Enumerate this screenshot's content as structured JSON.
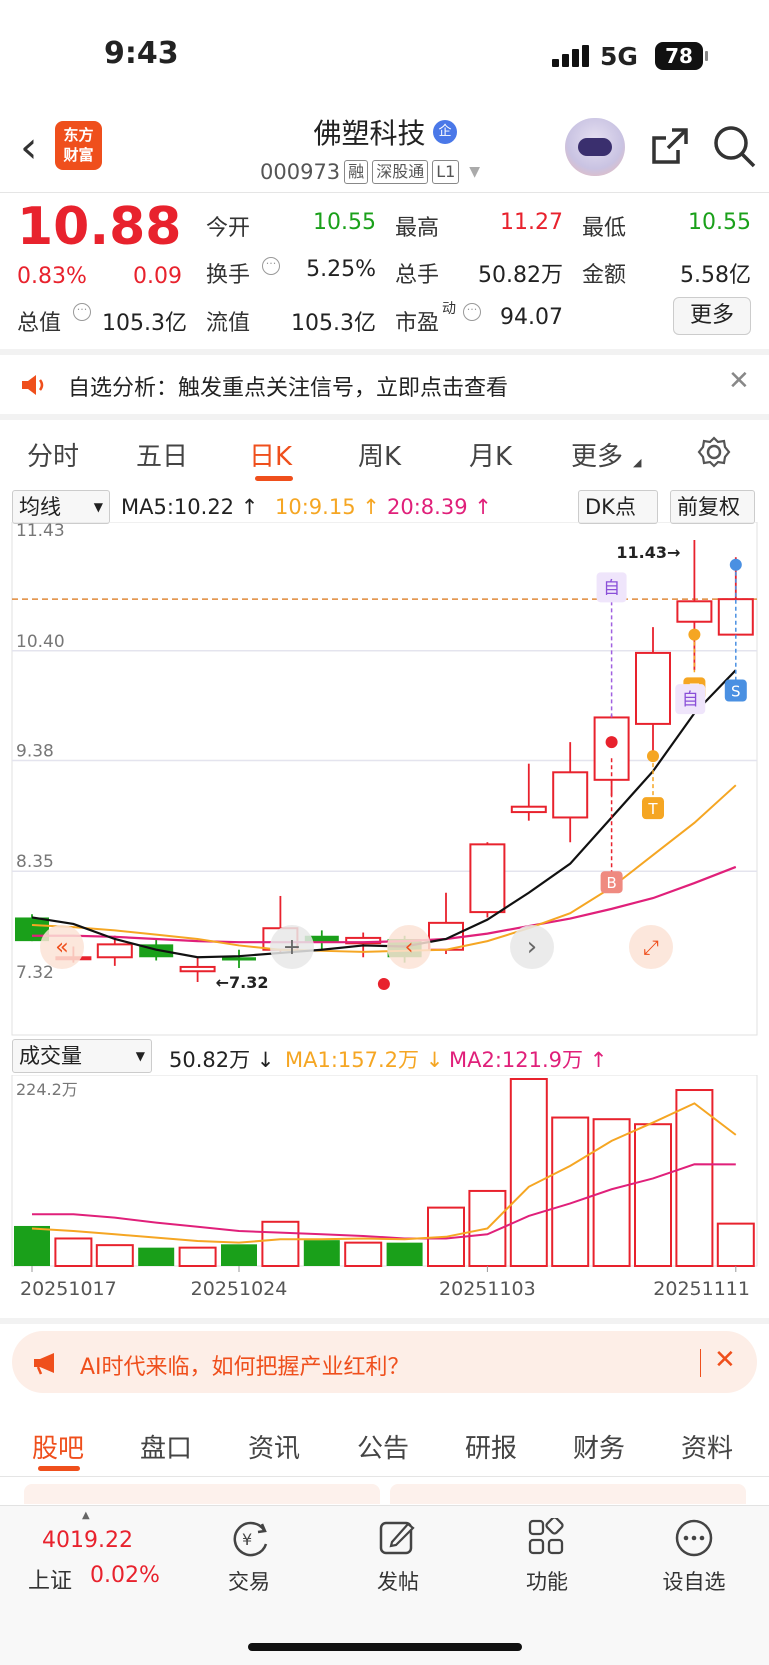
{
  "status": {
    "time": "9:43",
    "network": "5G",
    "battery": "78"
  },
  "header": {
    "logo_line1": "东方",
    "logo_line2": "财富",
    "stock_name": "佛塑科技",
    "badge": "企",
    "code": "000973",
    "tags": [
      "融",
      "深股通",
      "L1"
    ]
  },
  "quote": {
    "price": "10.88",
    "pct": "0.83%",
    "change": "0.09",
    "fields": [
      {
        "label": "今开",
        "value": "10.55",
        "color": "green"
      },
      {
        "label": "最高",
        "value": "11.27",
        "color": "red"
      },
      {
        "label": "最低",
        "value": "10.55",
        "color": "green"
      },
      {
        "label": "换手",
        "value": "5.25%",
        "color": "normal"
      },
      {
        "label": "总手",
        "value": "50.82万",
        "color": "normal"
      },
      {
        "label": "金额",
        "value": "5.58亿",
        "color": "normal"
      },
      {
        "label": "总值",
        "value": "105.3亿",
        "color": "normal"
      },
      {
        "label": "流值",
        "value": "105.3亿",
        "color": "normal"
      },
      {
        "label": "市盈",
        "superscript": "动",
        "value": "94.07",
        "color": "normal"
      }
    ],
    "more_button": "更多"
  },
  "notice": {
    "text": "自选分析：触发重点关注信号，立即点击查看"
  },
  "tabs": [
    "分时",
    "五日",
    "日K",
    "周K",
    "月K",
    "更多"
  ],
  "chart_controls": {
    "indicator": "均线",
    "ma5": "MA5:10.22",
    "ma10": "10:9.15",
    "ma20": "20:8.39",
    "dk": "DK点",
    "adjust": "前复权"
  },
  "chart_data": [
    {
      "type": "candlestick",
      "y_ticks": [
        "11.43",
        "10.40",
        "9.38",
        "8.35",
        "7.32"
      ],
      "ylim": [
        7.32,
        11.43
      ],
      "reference_line": 10.88,
      "max_label": "11.43",
      "min_label": "7.32",
      "candles": [
        {
          "o": 7.7,
          "c": 7.92,
          "h": 7.95,
          "l": 7.7,
          "up": false
        },
        {
          "o": 7.55,
          "c": 7.55,
          "h": 7.65,
          "l": 7.5,
          "up": true
        },
        {
          "o": 7.55,
          "c": 7.67,
          "h": 7.75,
          "l": 7.47,
          "up": true
        },
        {
          "o": 7.67,
          "c": 7.55,
          "h": 7.72,
          "l": 7.52,
          "up": false
        },
        {
          "o": 7.42,
          "c": 7.46,
          "h": 7.55,
          "l": 7.32,
          "up": true
        },
        {
          "o": 7.55,
          "c": 7.52,
          "h": 7.62,
          "l": 7.45,
          "up": false
        },
        {
          "o": 7.62,
          "c": 7.82,
          "h": 8.12,
          "l": 7.58,
          "up": true
        },
        {
          "o": 7.75,
          "c": 7.69,
          "h": 7.8,
          "l": 7.62,
          "up": false
        },
        {
          "o": 7.68,
          "c": 7.73,
          "h": 7.78,
          "l": 7.55,
          "up": true
        },
        {
          "o": 7.72,
          "c": 7.55,
          "h": 7.75,
          "l": 7.5,
          "up": false
        },
        {
          "o": 7.62,
          "c": 7.87,
          "h": 8.15,
          "l": 7.58,
          "up": true
        },
        {
          "o": 7.97,
          "c": 8.6,
          "h": 8.62,
          "l": 7.92,
          "up": true
        },
        {
          "o": 8.9,
          "c": 8.95,
          "h": 9.35,
          "l": 8.82,
          "up": true
        },
        {
          "o": 8.85,
          "c": 9.27,
          "h": 9.55,
          "l": 8.62,
          "up": true
        },
        {
          "o": 9.2,
          "c": 9.78,
          "h": 9.8,
          "l": 9.05,
          "up": true
        },
        {
          "o": 9.72,
          "c": 10.38,
          "h": 10.62,
          "l": 9.42,
          "up": true
        },
        {
          "o": 10.67,
          "c": 10.86,
          "h": 11.43,
          "l": 10.22,
          "up": true
        },
        {
          "o": 10.55,
          "c": 10.88,
          "h": 11.27,
          "l": 10.55,
          "up": true
        }
      ],
      "ma5": [
        7.92,
        7.86,
        7.72,
        7.62,
        7.55,
        7.56,
        7.59,
        7.62,
        7.66,
        7.65,
        7.72,
        7.9,
        8.15,
        8.42,
        8.85,
        9.28,
        9.82,
        10.22
      ],
      "ma10": [
        7.85,
        7.83,
        7.8,
        7.76,
        7.72,
        7.66,
        7.62,
        7.61,
        7.6,
        7.61,
        7.62,
        7.7,
        7.82,
        7.96,
        8.2,
        8.5,
        8.8,
        9.15
      ],
      "ma20": [
        7.75,
        7.75,
        7.74,
        7.72,
        7.7,
        7.69,
        7.69,
        7.69,
        7.69,
        7.7,
        7.72,
        7.77,
        7.84,
        7.91,
        8.0,
        8.1,
        8.24,
        8.39
      ],
      "markers": {
        "b_index": 14,
        "t_indices": [
          15,
          17
        ],
        "s_index": 18,
        "zi_indices": [
          15,
          17
        ]
      },
      "markers_text": {
        "b": "B",
        "t": "T",
        "s": "S",
        "zi": "自"
      }
    },
    {
      "type": "bar",
      "title": "成交量",
      "total": "50.82万",
      "ma1": "MA1:157.2万",
      "ma2": "MA2:121.9万",
      "ylim": [
        0,
        224.2
      ],
      "y_tick": "224.2万",
      "up": [
        false,
        true,
        true,
        false,
        true,
        false,
        true,
        false,
        true,
        false,
        true,
        true,
        true,
        true,
        true,
        true,
        true,
        true
      ],
      "values": [
        48,
        33,
        25,
        22,
        22,
        26,
        53,
        31,
        28,
        28,
        70,
        90,
        224.2,
        178,
        176,
        170,
        211,
        50.8
      ],
      "ma1_values": [
        45,
        42,
        38,
        34,
        30,
        28,
        32,
        32,
        33,
        32,
        35,
        45,
        95,
        120,
        150,
        172,
        195,
        157.2
      ],
      "ma2_values": [
        62,
        62,
        58,
        52,
        47,
        42,
        40,
        38,
        36,
        33,
        33,
        38,
        60,
        75,
        92,
        105,
        122,
        121.9
      ],
      "x_labels": [
        {
          "index": 0,
          "label": "20251017"
        },
        {
          "index": 5,
          "label": "20251024"
        },
        {
          "index": 11,
          "label": "20251103"
        },
        {
          "index": 17,
          "label": "20251111"
        }
      ]
    }
  ],
  "banner": {
    "text": "AI时代来临，如何把握产业红利？"
  },
  "bottom_tabs": [
    "股吧",
    "盘口",
    "资讯",
    "公告",
    "研报",
    "财务",
    "资料"
  ],
  "nav": {
    "index_value": "4019.22",
    "index_name": "上证",
    "index_pct": "0.02%",
    "items": [
      "交易",
      "发帖",
      "功能",
      "设自选"
    ]
  }
}
